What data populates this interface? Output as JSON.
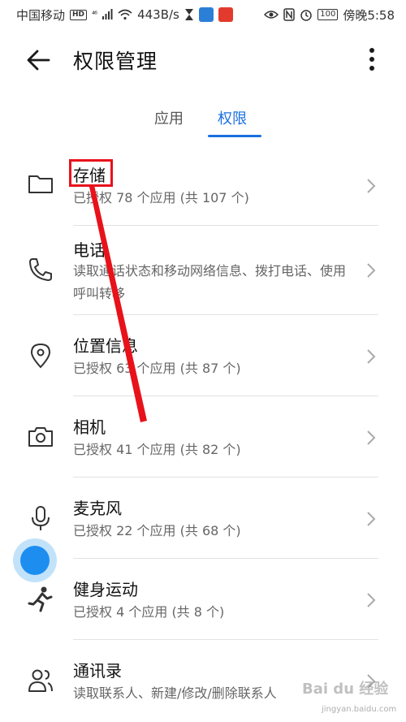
{
  "status_bar": {
    "carrier": "中国移动",
    "hd": "HD",
    "network": "⁴⁶",
    "speed": "443B/s",
    "battery": "100",
    "time": "傍晚5:58"
  },
  "header": {
    "title": "权限管理",
    "back_icon": "back-arrow-icon",
    "more_icon": "more-vertical-icon"
  },
  "tabs": [
    {
      "label": "应用",
      "active": false
    },
    {
      "label": "权限",
      "active": true
    }
  ],
  "accent_color": "#1a6fe0",
  "permissions": [
    {
      "icon": "folder-icon",
      "title": "存储",
      "subtitle": "已授权 78 个应用 (共 107 个)"
    },
    {
      "icon": "phone-icon",
      "title": "电话",
      "subtitle": "读取通话状态和移动网络信息、拨打电话、使用呼叫转移"
    },
    {
      "icon": "location-icon",
      "title": "位置信息",
      "subtitle": "已授权 63 个应用 (共 87 个)"
    },
    {
      "icon": "camera-icon",
      "title": "相机",
      "subtitle": "已授权 41 个应用 (共 82 个)"
    },
    {
      "icon": "microphone-icon",
      "title": "麦克风",
      "subtitle": "已授权 22 个应用 (共 68 个)"
    },
    {
      "icon": "running-icon",
      "title": "健身运动",
      "subtitle": "已授权 4 个应用 (共 8 个)"
    },
    {
      "icon": "contacts-icon",
      "title": "通讯录",
      "subtitle": "读取联系人、新建/修改/删除联系人"
    }
  ],
  "annotation_color": "#e8121a",
  "watermark": {
    "text": "Bai du 经验",
    "url": "jingyan.baidu.com"
  }
}
